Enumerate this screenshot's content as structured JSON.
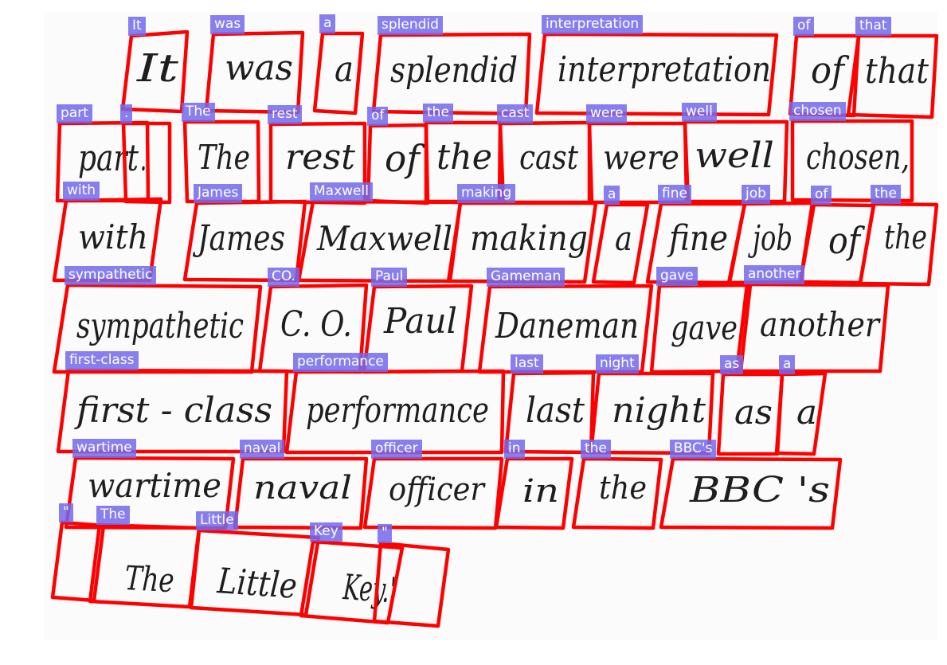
{
  "image_description": "Scanned handwritten text line page with detected word polygons and labels",
  "handwriting_lines": [
    "It was a splendid interpretation of that",
    "part . The rest of the cast were well chosen,",
    "with James Maxwell making a fine job of the",
    "sympathetic C.O. Paul Daneman gave another",
    "first-class performance last night as a",
    "wartime naval officer in the BBC's",
    "\" The Little Key.\""
  ],
  "ink_words": [
    "It",
    "was",
    "a",
    "splendid",
    "interpretation",
    "of",
    "that",
    "part",
    ".",
    "The",
    "rest",
    "of",
    "the",
    "cast",
    "were",
    "well",
    "chosen,",
    "with",
    "James",
    "Maxwell",
    "making",
    "a",
    "fine",
    "job",
    "of",
    "the",
    "sympathetic",
    "C. O.",
    "Paul",
    "Daneman",
    "gave",
    "another",
    "first - class",
    "performance",
    "last",
    "night",
    "as",
    "a",
    "wartime",
    "naval",
    "officer",
    "in",
    "the",
    "BBC 's",
    "'",
    "The",
    "Little",
    "Key.'"
  ],
  "detections": [
    {
      "label": "It"
    },
    {
      "label": "was"
    },
    {
      "label": "a"
    },
    {
      "label": "splendid"
    },
    {
      "label": "interpretation"
    },
    {
      "label": "of"
    },
    {
      "label": "that"
    },
    {
      "label": "part"
    },
    {
      "label": "."
    },
    {
      "label": "The"
    },
    {
      "label": "rest"
    },
    {
      "label": "of"
    },
    {
      "label": "the"
    },
    {
      "label": "cast"
    },
    {
      "label": "were"
    },
    {
      "label": "well"
    },
    {
      "label": "chosen"
    },
    {
      "label": "with"
    },
    {
      "label": "James"
    },
    {
      "label": "Maxwell"
    },
    {
      "label": "making"
    },
    {
      "label": "a"
    },
    {
      "label": "fine"
    },
    {
      "label": "job"
    },
    {
      "label": "of"
    },
    {
      "label": "the"
    },
    {
      "label": "sympathetic"
    },
    {
      "label": "CO."
    },
    {
      "label": "Paul"
    },
    {
      "label": "Gameman"
    },
    {
      "label": "gave"
    },
    {
      "label": "another"
    },
    {
      "label": "first-class"
    },
    {
      "label": "performance"
    },
    {
      "label": "last"
    },
    {
      "label": "night"
    },
    {
      "label": "as"
    },
    {
      "label": "a"
    },
    {
      "label": "wartime"
    },
    {
      "label": "naval"
    },
    {
      "label": "officer"
    },
    {
      "label": "in"
    },
    {
      "label": "the"
    },
    {
      "label": "BBC's"
    },
    {
      "label": "\""
    },
    {
      "label": "The"
    },
    {
      "label": "Little"
    },
    {
      "label": "Key"
    },
    {
      "label": "\""
    }
  ],
  "colors": {
    "box_stroke": "#ff0000",
    "label_bg": "#7369eb",
    "label_text": "#ffffff",
    "ink": "#1e1e1e",
    "paper": "#fbfbfb"
  }
}
